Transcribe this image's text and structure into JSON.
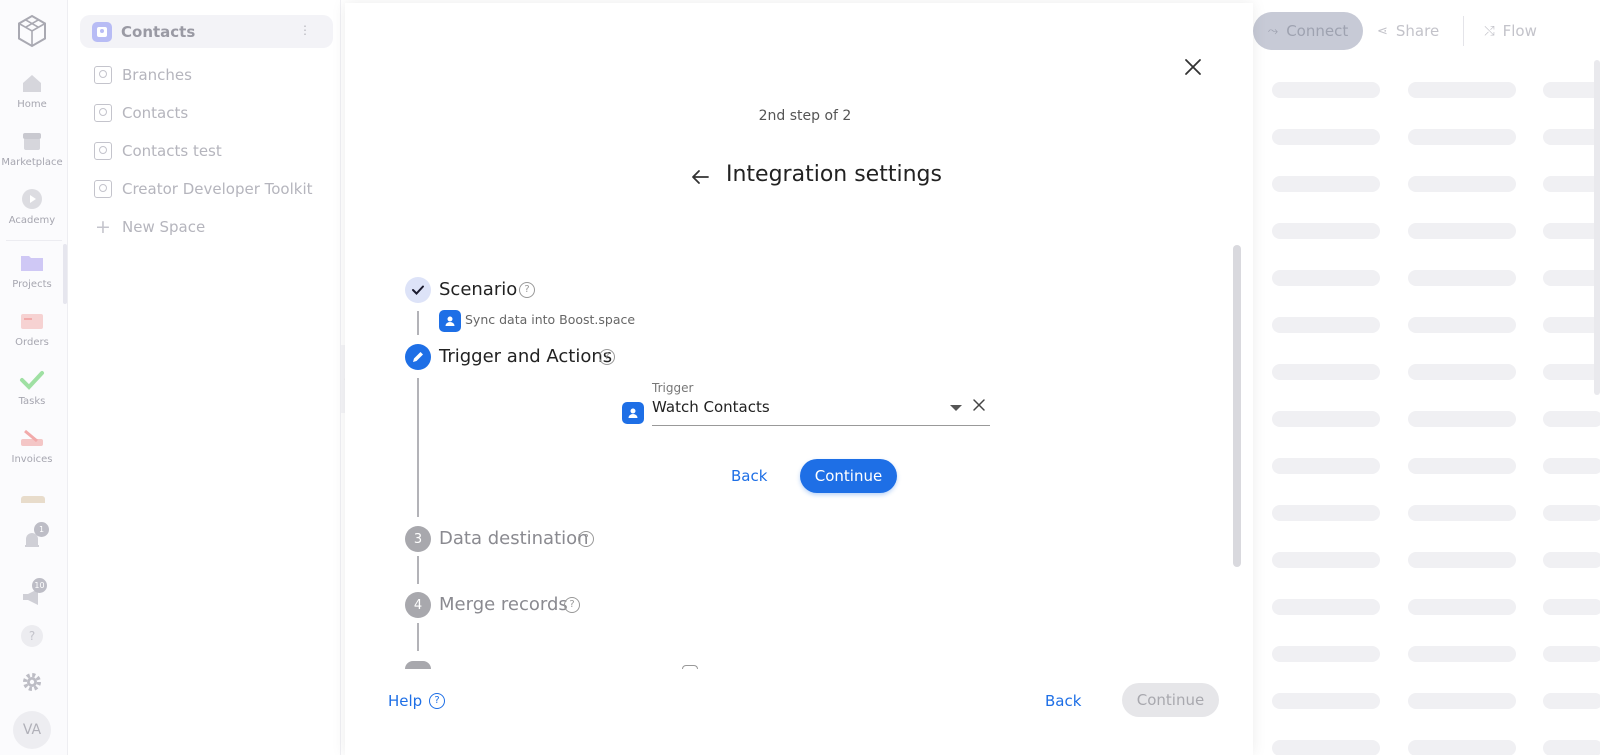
{
  "rail": {
    "items": [
      {
        "label": "Home",
        "icon": "home-icon"
      },
      {
        "label": "Marketplace",
        "icon": "store-icon"
      },
      {
        "label": "Academy",
        "icon": "play-icon"
      },
      {
        "label": "Projects",
        "icon": "folder-icon"
      },
      {
        "label": "Orders",
        "icon": "orders-icon"
      },
      {
        "label": "Tasks",
        "icon": "check-icon"
      },
      {
        "label": "Invoices",
        "icon": "invoice-icon"
      }
    ],
    "notifications_count": "1",
    "announcements_count": "10",
    "avatar_initials": "VA"
  },
  "sidebar": {
    "title": "Contacts",
    "items": [
      {
        "label": "Branches"
      },
      {
        "label": "Contacts"
      },
      {
        "label": "Contacts test"
      },
      {
        "label": "Creator Developer Toolkit"
      }
    ],
    "new_space": "New Space"
  },
  "topbar": {
    "connect": "Connect",
    "share": "Share",
    "flow": "Flow"
  },
  "modal": {
    "step_indicator": "2nd step of 2",
    "title": "Integration settings",
    "steps": [
      {
        "number": "",
        "label": "Scenario",
        "status": "done"
      },
      {
        "number": "",
        "label": "Trigger and Actions",
        "status": "active"
      },
      {
        "number": "3",
        "label": "Data destination",
        "status": "pending"
      },
      {
        "number": "4",
        "label": "Merge records",
        "status": "pending"
      }
    ],
    "scenario_value": "Sync data into Boost.space",
    "trigger": {
      "label": "Trigger",
      "value": "Watch Contacts"
    },
    "inner_back": "Back",
    "inner_continue": "Continue",
    "help": "Help",
    "footer_back": "Back",
    "footer_continue": "Continue"
  },
  "colors": {
    "accent": "#1e6fe6",
    "step_done_bg": "#dde3f8",
    "step_pending_bg": "#a8a8ad"
  }
}
